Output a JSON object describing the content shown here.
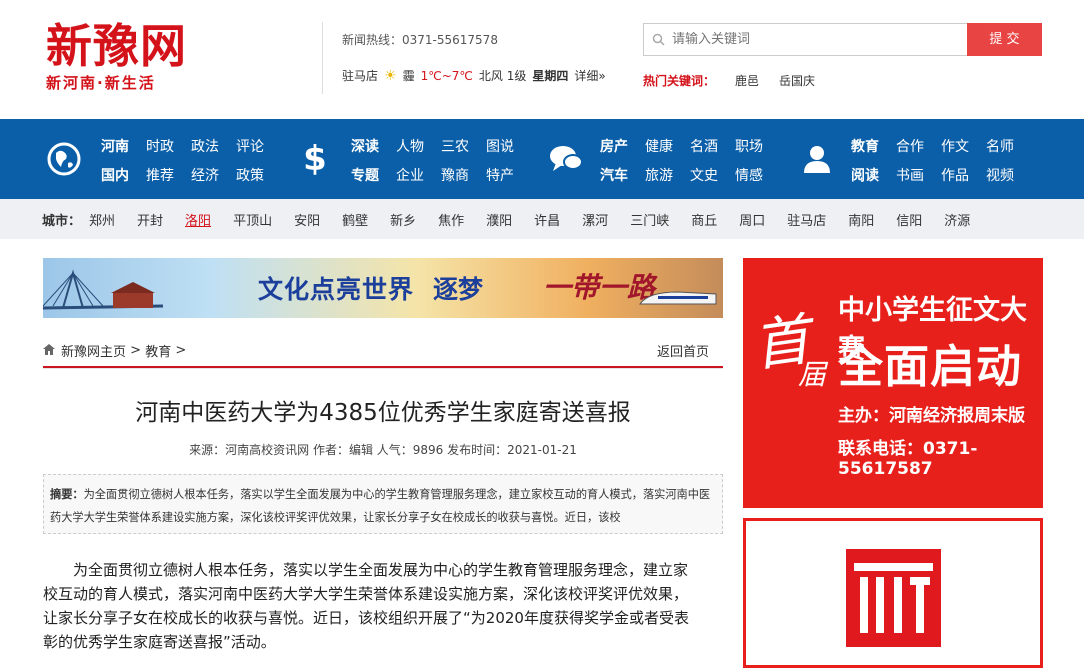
{
  "logo": {
    "main": "新豫网",
    "sub": "新河南·新生活"
  },
  "header": {
    "hotline": "新闻热线：0371-55617578",
    "weather": {
      "city": "驻马店",
      "condition": "霾",
      "temp": "1℃~7℃",
      "wind": "北风 1级",
      "day": "星期四",
      "more": "详细»"
    },
    "search": {
      "placeholder": "请输入关键词",
      "button": "提 交"
    },
    "hot_keywords": {
      "label": "热门关键词：",
      "items": [
        "鹿邑",
        "岳国庆"
      ]
    }
  },
  "nav": {
    "groups": [
      {
        "icon": "globe-icon",
        "row1": [
          "河南",
          "时政",
          "政法",
          "评论"
        ],
        "row2": [
          "国内",
          "推荐",
          "经济",
          "政策"
        ]
      },
      {
        "icon": "dollar-icon",
        "row1": [
          "深读",
          "人物",
          "三农",
          "图说"
        ],
        "row2": [
          "专题",
          "企业",
          "豫商",
          "特产"
        ]
      },
      {
        "icon": "chat-icon",
        "row1": [
          "房产",
          "健康",
          "名酒",
          "职场"
        ],
        "row2": [
          "汽车",
          "旅游",
          "文史",
          "情感"
        ]
      },
      {
        "icon": "user-icon",
        "row1": [
          "教育",
          "合作",
          "作文",
          "名师"
        ],
        "row2": [
          "阅读",
          "书画",
          "作品",
          "视频"
        ]
      }
    ]
  },
  "city_bar": {
    "label": "城市：",
    "items": [
      "郑州",
      "开封",
      "洛阳",
      "平顶山",
      "安阳",
      "鹤壁",
      "新乡",
      "焦作",
      "濮阳",
      "许昌",
      "漯河",
      "三门峡",
      "商丘",
      "周口",
      "驻马店",
      "南阳",
      "信阳",
      "济源"
    ],
    "active": "洛阳"
  },
  "banner": {
    "text1": "文化点亮世界",
    "text2": "逐梦",
    "text3": "一带一路"
  },
  "breadcrumb": {
    "home": "新豫网主页",
    "sep1": " > ",
    "section": "教育",
    "sep2": " >",
    "back": "返回首页"
  },
  "article": {
    "title": "河南中医药大学为4385位优秀学生家庭寄送喜报",
    "meta": "来源：河南高校资讯网 作者：编辑 人气：9896 发布时间：2021-01-21",
    "summary_label": "摘要：",
    "summary": "为全面贯彻立德树人根本任务，落实以学生全面发展为中心的学生教育管理服务理念，建立家校互动的育人模式，落实河南中医药大学大学生荣誉体系建设实施方案，深化该校评奖评优效果，让家长分享子女在校成长的收获与喜悦。近日，该校",
    "body": "为全面贯彻立德树人根本任务，落实以学生全面发展为中心的学生教育管理服务理念，建立家校互动的育人模式，落实河南中医药大学大学生荣誉体系建设实施方案，深化该校评奖评优效果，让家长分享子女在校成长的收获与喜悦。近日，该校组织开展了“为2020年度获得奖学金或者受表彰的优秀学生家庭寄送喜报”活动。"
  },
  "side_ad": {
    "calligraphy": "首",
    "calligraphy2": "届",
    "title": "中小学生征文大赛",
    "big": "全面启动",
    "host": "主办：河南经济报周末版",
    "phone": "联系电话：0371-55617587"
  }
}
